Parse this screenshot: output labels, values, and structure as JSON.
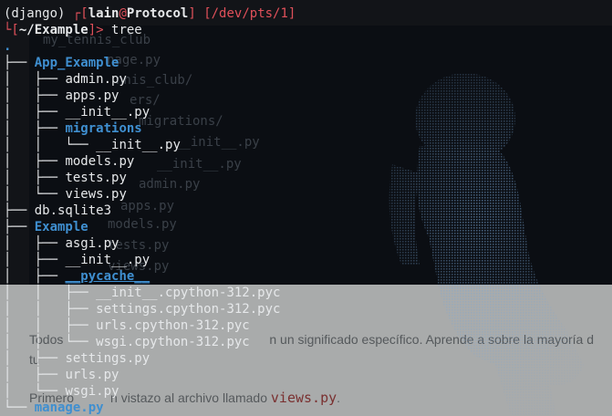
{
  "prompt": {
    "env": "(django)",
    "bracket_open": "┌[",
    "user": "lain",
    "at": "@",
    "host": "Protocol",
    "bracket_close": "]",
    "tty": "[/dev/pts/1]",
    "line2_prefix": "└[",
    "cwd": "~/Example",
    "line2_suffix": "]>",
    "command": "tree"
  },
  "tree": {
    "root": ".",
    "lines": [
      {
        "prefix": "├── ",
        "name": "App_Example",
        "type": "dir"
      },
      {
        "prefix": "│   ├── ",
        "name": "admin.py",
        "type": "file"
      },
      {
        "prefix": "│   ├── ",
        "name": "apps.py",
        "type": "file"
      },
      {
        "prefix": "│   ├── ",
        "name": "__init__.py",
        "type": "file"
      },
      {
        "prefix": "│   ├── ",
        "name": "migrations",
        "type": "dir"
      },
      {
        "prefix": "│   │   └── ",
        "name": "__init__.py",
        "type": "file"
      },
      {
        "prefix": "│   ├── ",
        "name": "models.py",
        "type": "file"
      },
      {
        "prefix": "│   ├── ",
        "name": "tests.py",
        "type": "file"
      },
      {
        "prefix": "│   └── ",
        "name": "views.py",
        "type": "file"
      },
      {
        "prefix": "├── ",
        "name": "db.sqlite3",
        "type": "file"
      },
      {
        "prefix": "├── ",
        "name": "Example",
        "type": "dir"
      },
      {
        "prefix": "│   ├── ",
        "name": "asgi.py",
        "type": "file"
      },
      {
        "prefix": "│   ├── ",
        "name": "__init__.py",
        "type": "file"
      },
      {
        "prefix": "│   ├── ",
        "name": "__pycache__",
        "type": "dir"
      },
      {
        "prefix": "│   │   ├── ",
        "name": "__init__.cpython-312.pyc",
        "type": "file"
      },
      {
        "prefix": "│   │   ├── ",
        "name": "settings.cpython-312.pyc",
        "type": "file"
      },
      {
        "prefix": "│   │   ├── ",
        "name": "urls.cpython-312.pyc",
        "type": "file"
      },
      {
        "prefix": "│   │   └── ",
        "name": "wsgi.cpython-312.pyc",
        "type": "file"
      },
      {
        "prefix": "│   ├── ",
        "name": "settings.py",
        "type": "file"
      },
      {
        "prefix": "│   ├── ",
        "name": "urls.py",
        "type": "file"
      },
      {
        "prefix": "│   └── ",
        "name": "wsgi.py",
        "type": "file"
      },
      {
        "prefix": "└── ",
        "name": "manage.py",
        "type": "dir"
      }
    ]
  },
  "background_window": {
    "ghost_lines": [
      "my_tennis_club",
      "nage.py",
      "nnis_club/",
      "ers/",
      "migrations/",
      "__init__.py",
      "__init__.py",
      "admin.py",
      "apps.py",
      "models.py",
      "tests.py",
      "views.py"
    ],
    "para1_start": "Todos",
    "para1_mid": "n un significado específico. Aprende a sobre la mayoría d",
    "para1_line2": "tu",
    "para2_start": "Primero",
    "para2_mid": "n vistazo al archivo llamado",
    "para2_code": "views.py",
    "para2_end": "."
  },
  "colors": {
    "terminal_bg": "#121418",
    "directory": "#3f8fd0",
    "prompt_accent": "#e0505a",
    "text": "#e6e8ea"
  }
}
